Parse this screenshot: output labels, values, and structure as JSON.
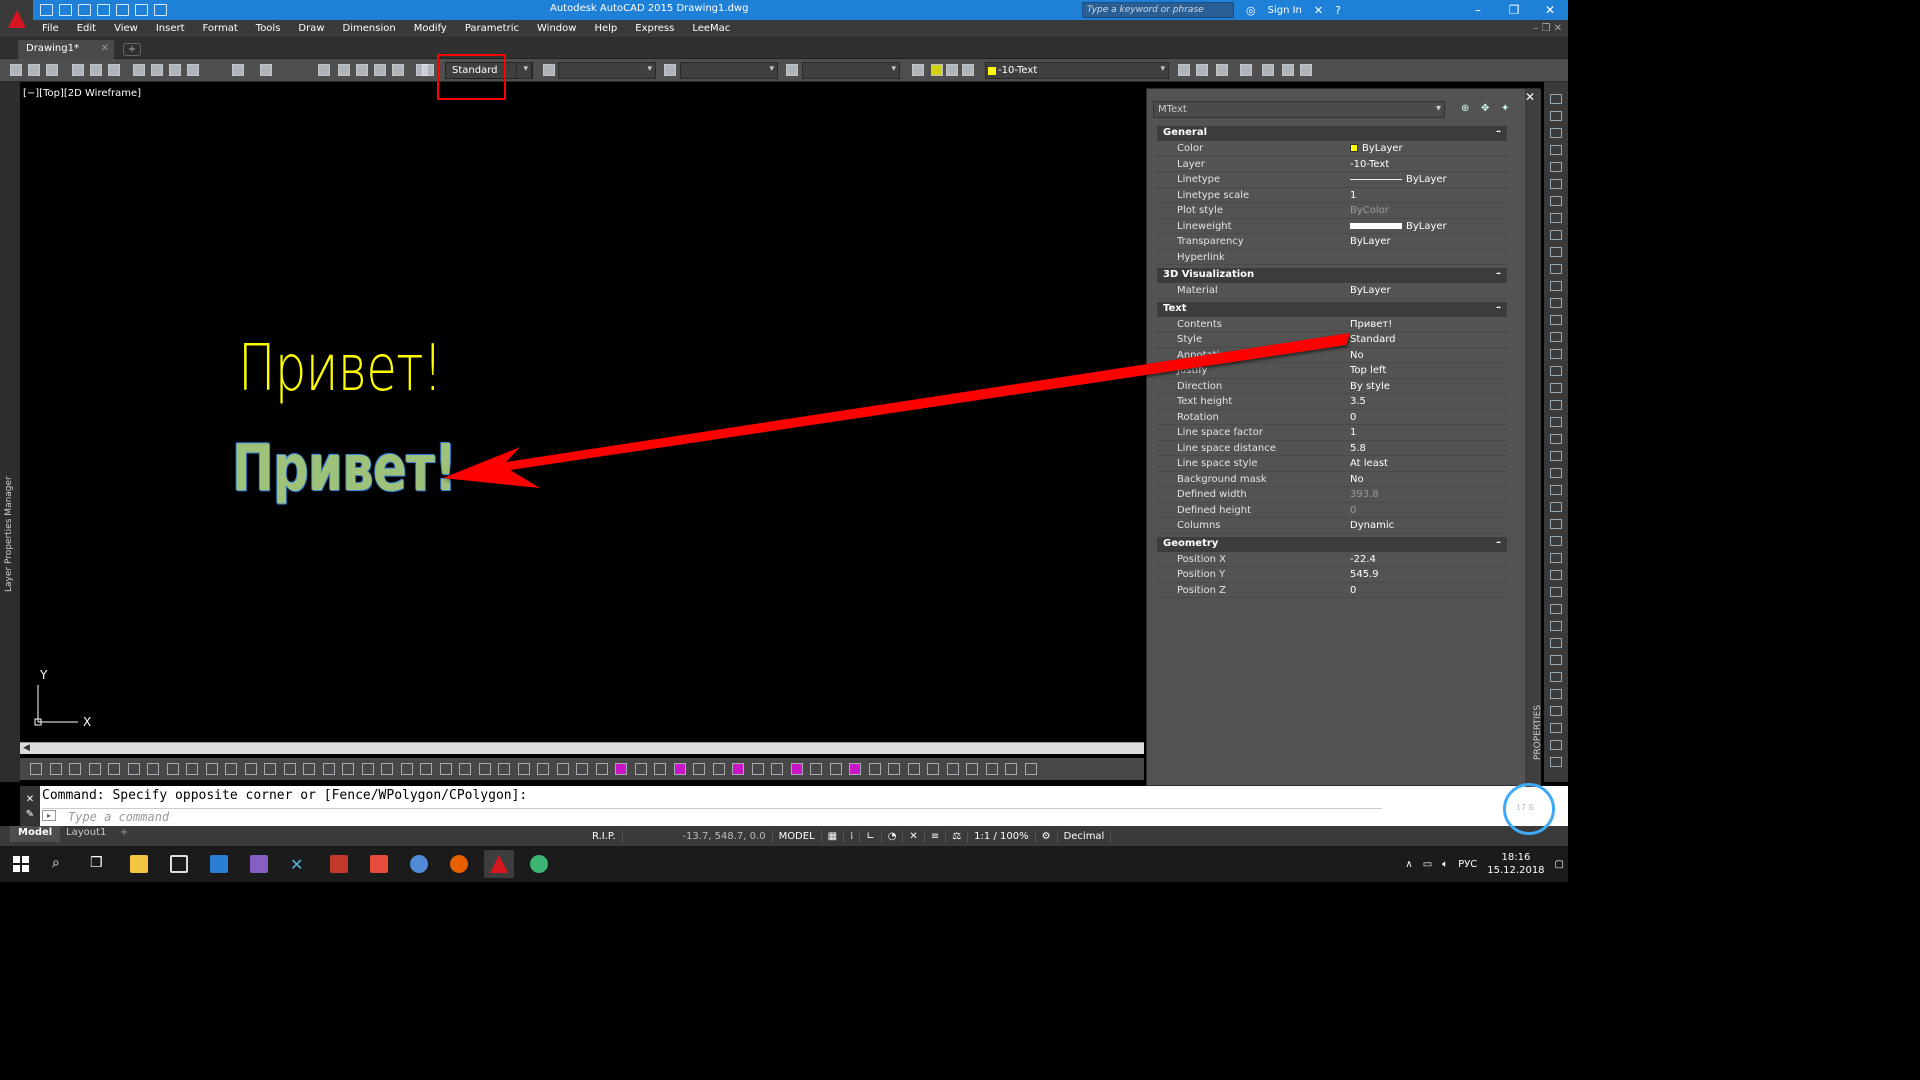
{
  "window": {
    "title": "Autodesk AutoCAD 2015    Drawing1.dwg",
    "search_placeholder": "Type a keyword or phrase",
    "sign_in": "Sign In"
  },
  "menu": [
    "File",
    "Edit",
    "View",
    "Insert",
    "Format",
    "Tools",
    "Draw",
    "Dimension",
    "Modify",
    "Parametric",
    "Window",
    "Help",
    "Express",
    "LeeMac"
  ],
  "doc_tab": {
    "label": "Drawing1*",
    "close": "✕",
    "new": "+"
  },
  "toolbar": {
    "text_style": "Standard",
    "layer": "-10-Text"
  },
  "left_panel_label": "Layer Properties Manager",
  "viewport": {
    "label": "[−][Top][2D Wireframe]",
    "text_yellow": "Привет!",
    "text_selected": "Привет!",
    "ucs_x": "X",
    "ucs_y": "Y"
  },
  "command": {
    "history": "Command: Specify opposite corner or [Fence/WPolygon/CPolygon]:",
    "placeholder": "Type a command"
  },
  "layout_tabs": {
    "model": "Model",
    "layout1": "Layout1",
    "plus": "+"
  },
  "status": {
    "rip": "R.I.P.",
    "coords": "-13.7, 548.7, 0.0",
    "model": "MODEL",
    "scale": "1:1 / 100%",
    "units": "Decimal"
  },
  "properties": {
    "object_type": "MText",
    "panel_label": "PROPERTIES",
    "sections": [
      {
        "title": "General",
        "rows": [
          {
            "key": "Color",
            "value": "ByLayer"
          },
          {
            "key": "Layer",
            "value": "-10-Text"
          },
          {
            "key": "Linetype",
            "value": "ByLayer"
          },
          {
            "key": "Linetype scale",
            "value": "1"
          },
          {
            "key": "Plot style",
            "value": "ByColor"
          },
          {
            "key": "Lineweight",
            "value": "ByLayer"
          },
          {
            "key": "Transparency",
            "value": "ByLayer"
          },
          {
            "key": "Hyperlink",
            "value": ""
          }
        ]
      },
      {
        "title": "3D Visualization",
        "rows": [
          {
            "key": "Material",
            "value": "ByLayer"
          }
        ]
      },
      {
        "title": "Text",
        "rows": [
          {
            "key": "Contents",
            "value": "Привет!"
          },
          {
            "key": "Style",
            "value": "Standard"
          },
          {
            "key": "Annotative",
            "value": "No"
          },
          {
            "key": "Justify",
            "value": "Top left"
          },
          {
            "key": "Direction",
            "value": "By style"
          },
          {
            "key": "Text height",
            "value": "3.5"
          },
          {
            "key": "Rotation",
            "value": "0"
          },
          {
            "key": "Line space factor",
            "value": "1"
          },
          {
            "key": "Line space distance",
            "value": "5.8"
          },
          {
            "key": "Line space style",
            "value": "At least"
          },
          {
            "key": "Background mask",
            "value": "No"
          },
          {
            "key": "Defined width",
            "value": "393.8"
          },
          {
            "key": "Defined height",
            "value": "0"
          },
          {
            "key": "Columns",
            "value": "Dynamic"
          }
        ]
      },
      {
        "title": "Geometry",
        "rows": [
          {
            "key": "Position X",
            "value": "-22.4"
          },
          {
            "key": "Position Y",
            "value": "545.9"
          },
          {
            "key": "Position Z",
            "value": "0"
          }
        ]
      }
    ]
  },
  "taskbar": {
    "lang": "РУС",
    "time": "18:16",
    "date": "15.12.2018"
  },
  "overlay_text": "17 Б",
  "colors": {
    "title_bar": "#1f80d8",
    "yellow_text": "#ffff00",
    "selected_fill": "#9ec27a",
    "annotation_red": "#ff0000"
  }
}
